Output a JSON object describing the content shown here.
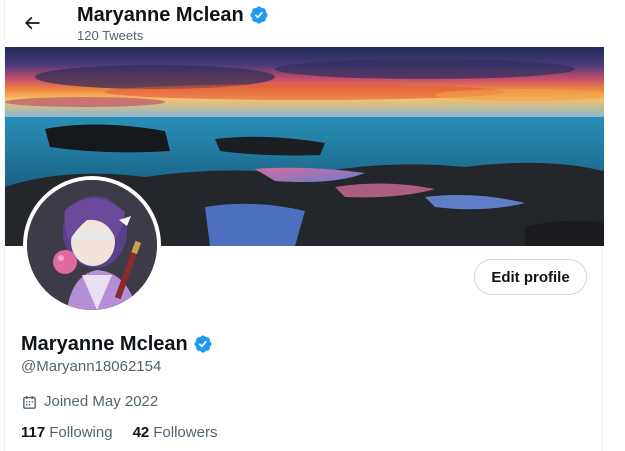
{
  "header": {
    "name": "Maryanne Mclean",
    "tweet_count": "120 Tweets"
  },
  "profile": {
    "display_name": "Maryanne Mclean",
    "handle": "@Maryann18062154",
    "joined": "Joined May 2022",
    "edit_label": "Edit profile",
    "verified": true
  },
  "stats": {
    "following_count": "117",
    "following_label": "Following",
    "followers_count": "42",
    "followers_label": "Followers"
  },
  "icons": {
    "back": "arrow-left-icon",
    "verified": "verified-badge-icon",
    "calendar": "calendar-icon"
  },
  "colors": {
    "accent": "#1d9bf0",
    "text_primary": "#0f1419",
    "text_secondary": "#536471",
    "border": "#cfd9de"
  }
}
